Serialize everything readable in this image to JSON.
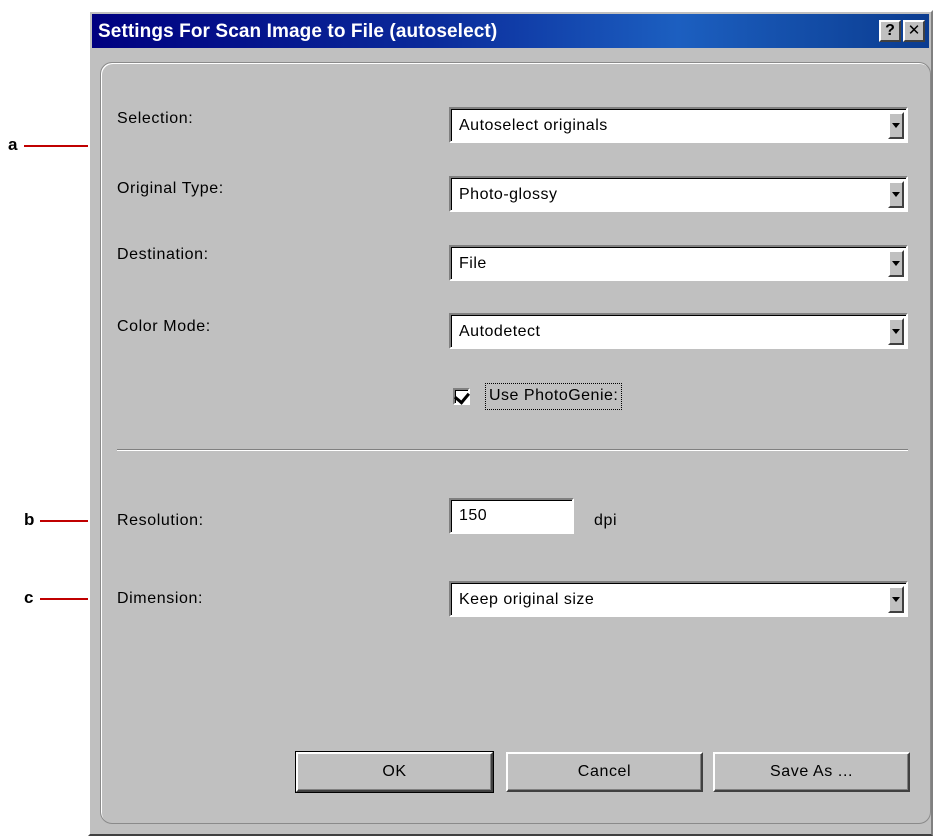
{
  "window": {
    "title": "Settings For Scan Image to File (autoselect)",
    "help_label": "?",
    "close_label": "✕"
  },
  "form": {
    "selection": {
      "label": "Selection:",
      "value": "Autoselect originals"
    },
    "original_type": {
      "label": "Original Type:",
      "value": "Photo-glossy"
    },
    "destination": {
      "label": "Destination:",
      "value": "File"
    },
    "color_mode": {
      "label": "Color Mode:",
      "value": "Autodetect"
    },
    "photogenie": {
      "label": "Use PhotoGenie:",
      "checked": true
    },
    "resolution": {
      "label": "Resolution:",
      "value": "150",
      "unit": "dpi"
    },
    "dimension": {
      "label": "Dimension:",
      "value": "Keep original size"
    }
  },
  "buttons": {
    "ok": "OK",
    "cancel": "Cancel",
    "save_as": "Save As ..."
  },
  "callouts": {
    "a": "a",
    "b": "b",
    "c": "c",
    "line_color": "#c00000"
  }
}
